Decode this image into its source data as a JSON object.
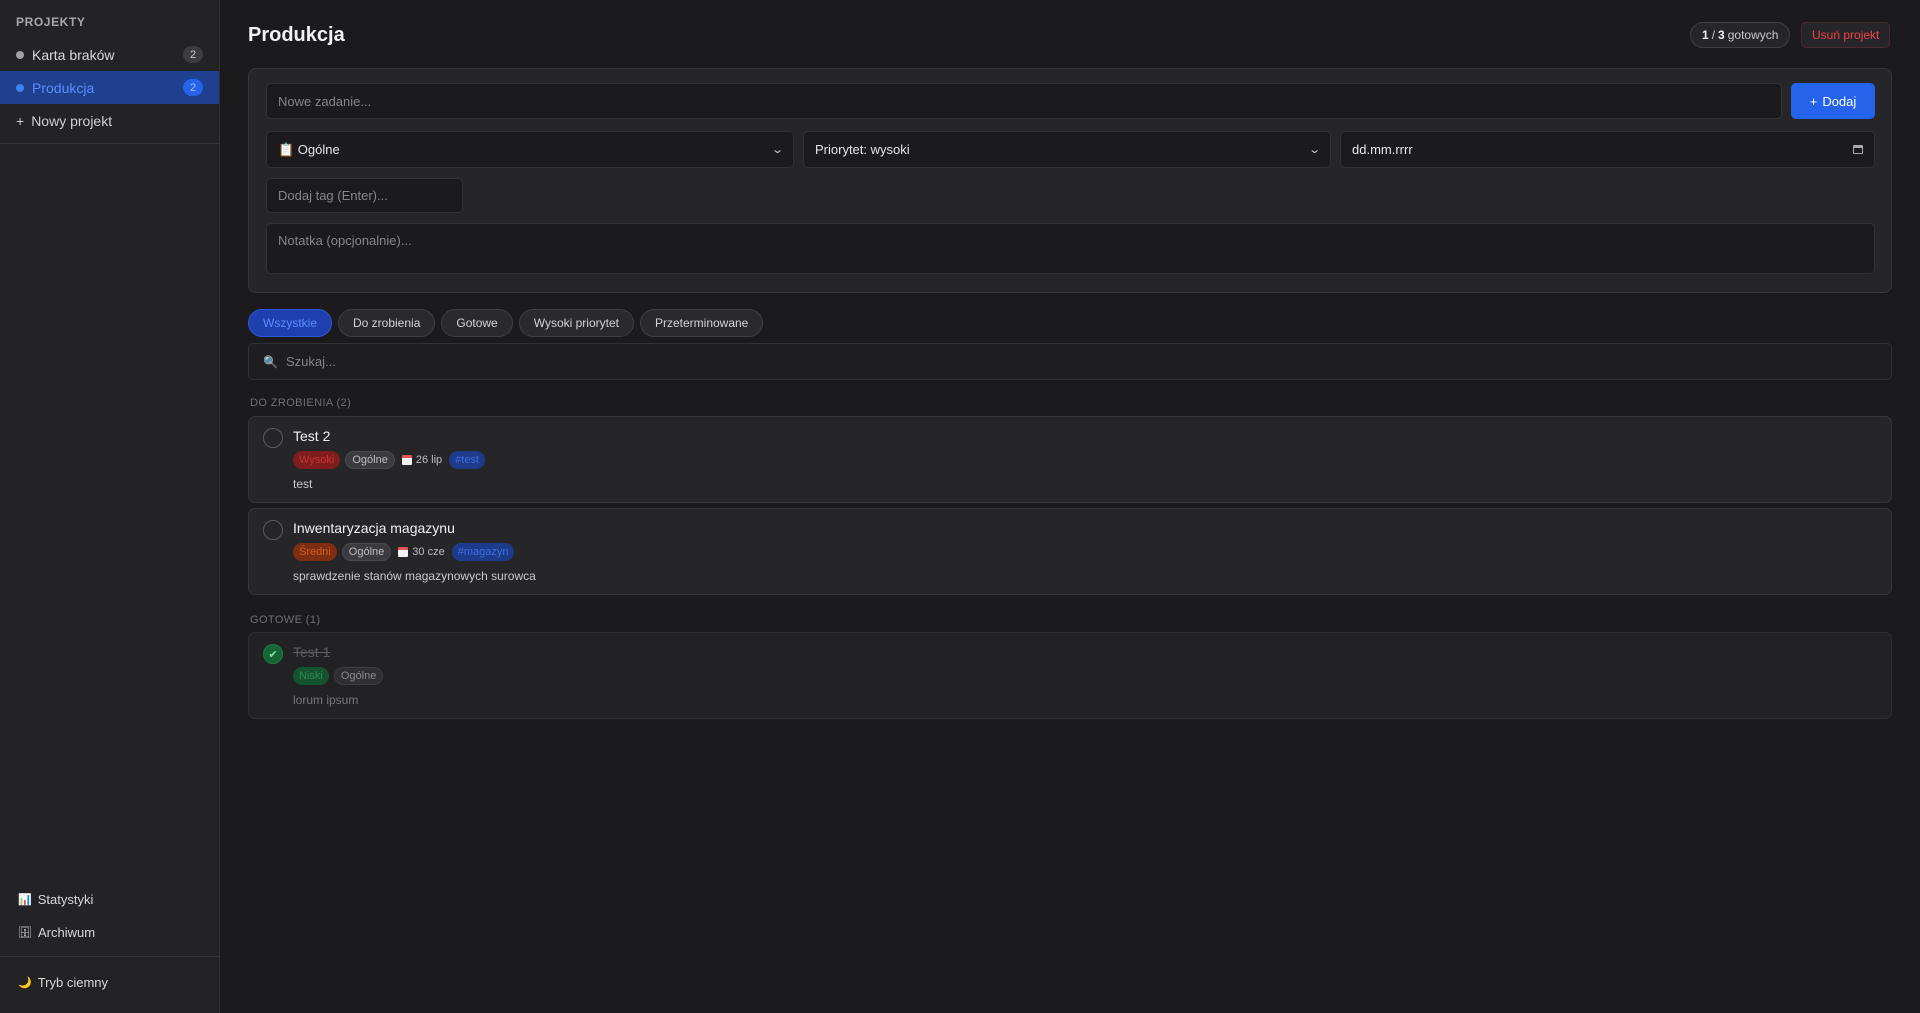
{
  "sidebar": {
    "heading": "PROJEKTY",
    "projects": [
      {
        "name": "Karta braków",
        "count": "2"
      },
      {
        "name": "Produkcja",
        "count": "2"
      }
    ],
    "new_project": "Nowy projekt",
    "links": {
      "stats": "Statystyki",
      "archive": "Archiwum",
      "dark_mode": "Tryb ciemny"
    }
  },
  "header": {
    "title": "Produkcja",
    "done": "1",
    "total": "3",
    "done_suffix": "gotowych",
    "delete_label": "Usuń projekt"
  },
  "form": {
    "task_placeholder": "Nowe zadanie...",
    "add_label": "Dodaj",
    "category": "📋 Ogólne",
    "priority": "Priorytet: wysoki",
    "date": "dd.mm.rrrr",
    "tag_placeholder": "Dodaj tag (Enter)...",
    "note_placeholder": "Notatka (opcjonalnie)..."
  },
  "filters": [
    "Wszystkie",
    "Do zrobienia",
    "Gotowe",
    "Wysoki priorytet",
    "Przeterminowane"
  ],
  "search_placeholder": "Szukaj...",
  "sections": {
    "todo": "DO ZROBIENIA (2)",
    "done": "GOTOWE (1)"
  },
  "tasks_todo": [
    {
      "title": "Test 2",
      "priority": "Wysoki",
      "category": "Ogólne",
      "date": "26 lip",
      "tag": "#test",
      "note": "test"
    },
    {
      "title": "Inwentaryzacja magazynu",
      "priority": "Średni",
      "category": "Ogólne",
      "date": "30 cze",
      "tag": "#magazyn",
      "note": "sprawdzenie stanów magazynowych surowca"
    }
  ],
  "tasks_done": [
    {
      "title": "Test 1",
      "priority": "Niski",
      "category": "Ogólne",
      "note": "lorum ipsum"
    }
  ],
  "colors": {
    "accent": "#2563eb",
    "danger": "#ef4444",
    "background": "#1b1b1e",
    "sidebar": "#232326"
  }
}
